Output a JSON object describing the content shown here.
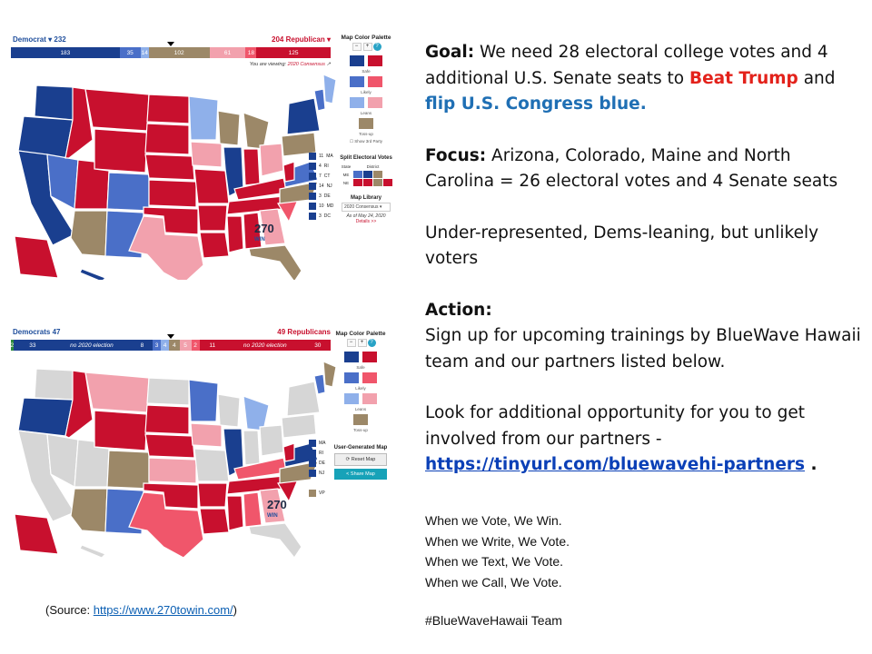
{
  "map_top": {
    "dem_label": "Democrat",
    "dem_total": "232",
    "rep_total": "204",
    "rep_label": "Republican",
    "bar": [
      "183",
      "35",
      "14",
      "102",
      "61",
      "18",
      "125"
    ],
    "viewing_prefix": "You are viewing:",
    "viewing_value": "2020 Consensus",
    "palette_title": "Map Color Palette",
    "palette_labels": [
      "Safe",
      "Likely",
      "Leans",
      "Toss-up"
    ],
    "show_third_party": "Show 3rd Party",
    "split_title": "Split Electoral Votes",
    "split_headers": [
      "State",
      "District"
    ],
    "split_rows": [
      "ME",
      "NE"
    ],
    "library_title": "Map Library",
    "library_select": "2020 Consensus",
    "as_of": "As of May 24, 2020",
    "details": "Details >>",
    "side_states": [
      "MA",
      "RI",
      "CT",
      "NJ",
      "DE",
      "MD",
      "DC"
    ],
    "side_values": [
      "11",
      "4",
      "7",
      "14",
      "3",
      "10",
      "3"
    ],
    "logo_num": "270",
    "logo_win": "WIN"
  },
  "map_bottom": {
    "dem_label": "Democrats",
    "dem_total": "47",
    "rep_total": "49",
    "rep_label": "Republicans",
    "bar": [
      "2",
      "33",
      "no 2020 election",
      "8",
      "3",
      "4",
      "4",
      "5",
      "2",
      "11",
      "no 2020 election",
      "30"
    ],
    "palette_title": "Map Color Palette",
    "palette_labels": [
      "Safe",
      "Likely",
      "Leans",
      "Toss-up"
    ],
    "user_map_title": "User-Generated Map",
    "reset_label": "Reset Map",
    "share_label": "Share Map",
    "side_states": [
      "MA",
      "RI",
      "DE",
      "NJ",
      "VP"
    ],
    "logo_num": "270",
    "logo_win": "WIN"
  },
  "source": {
    "prefix": "(Source: ",
    "url": "https://www.270towin.com/",
    "suffix": ")"
  },
  "text": {
    "goal_label": "Goal:",
    "goal_1": "We need 28 electoral college votes and 4 additional U.S. Senate seats to",
    "goal_red": "Beat Trump",
    "goal_and": "and",
    "goal_blue": "flip U.S. Congress blue.",
    "focus_label": "Focus:",
    "focus_text": "Arizona, Colorado, Maine and North Carolina = 26 electoral votes and 4 Senate seats",
    "under": "Under-represented, Dems-leaning, but unlikely voters",
    "action_label": "Action:",
    "action_text": "Sign up for upcoming trainings by BlueWave Hawaii team and our partners listed below.",
    "look_text": "Look for additional opportunity for you to get involved from our partners -",
    "partners_link": "https://tinyurl.com/bluewavehi-partners",
    "period": " .",
    "slogans": [
      "When we Vote, We Win.",
      "When we Write, We Vote.",
      "When we Text, We Vote.",
      "When we Call, We Vote."
    ],
    "hashtag": "#BlueWaveHawaii Team"
  },
  "colors": {
    "safe_dem": "#1a3f8f",
    "likely_dem": "#4a6fc8",
    "leans_dem": "#8fb0ea",
    "tossup": "#9c8868",
    "leans_rep": "#f2a1ad",
    "likely_rep": "#f0566b",
    "safe_rep": "#c8102e",
    "no_election": "#d6d6d6",
    "green": "#2e8b3e"
  }
}
